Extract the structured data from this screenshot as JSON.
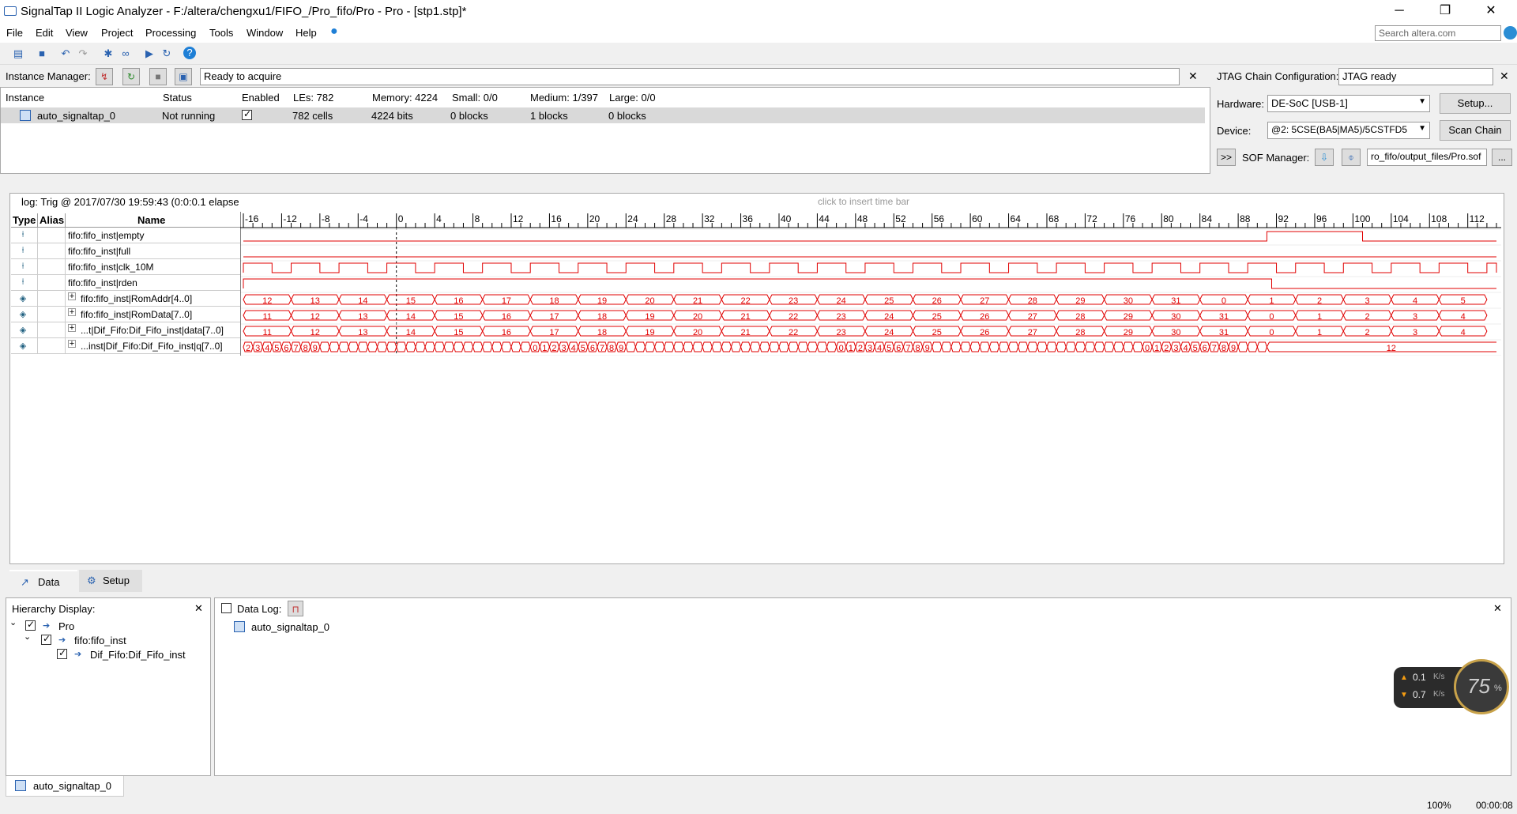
{
  "window": {
    "title": "SignalTap II Logic Analyzer - F:/altera/chengxu1/FIFO_/Pro_fifo/Pro - Pro - [stp1.stp]*",
    "minimize": "─",
    "maximize": "❐",
    "close": "✕"
  },
  "menu": [
    "File",
    "Edit",
    "View",
    "Project",
    "Processing",
    "Tools",
    "Window",
    "Help"
  ],
  "search_placeholder": "Search altera.com",
  "instance_manager": {
    "label": "Instance Manager:",
    "status": "Ready to acquire",
    "columns": [
      "Instance",
      "Status",
      "Enabled",
      "LEs: 782",
      "Memory: 4224",
      "Small: 0/0",
      "Medium: 1/397",
      "Large: 0/0"
    ],
    "row": {
      "instance": "auto_signaltap_0",
      "status": "Not running",
      "les": "782 cells",
      "memory": "4224 bits",
      "small": "0 blocks",
      "medium": "1 blocks",
      "large": "0 blocks"
    }
  },
  "jtag": {
    "label": "JTAG Chain Configuration:",
    "status": "JTAG ready",
    "hardware_label": "Hardware:",
    "hardware": "DE-SoC [USB-1]",
    "setup_button": "Setup...",
    "device_label": "Device:",
    "device": "@2: 5CSE(BA5|MA5)/5CSTFD5",
    "scan_button": "Scan Chain",
    "expand": ">>",
    "sof_label": "SOF Manager:",
    "sof_path": "ro_fifo/output_files/Pro.sof",
    "browse": "..."
  },
  "waveform": {
    "log": "log: Trig @ 2017/07/30 19:59:43 (0:0:0.1 elapse",
    "hint": "click to insert time bar",
    "headers": {
      "type": "Type",
      "alias": "Alias",
      "name": "Name"
    },
    "ticks": [
      "-16",
      "-12",
      "-8",
      "-4",
      "0",
      "4",
      "8",
      "12",
      "16",
      "20",
      "24",
      "28",
      "32",
      "36",
      "40",
      "44",
      "48",
      "52",
      "56",
      "60",
      "64",
      "68",
      "72",
      "76",
      "80",
      "84",
      "88",
      "92",
      "96",
      "100",
      "104",
      "108",
      "112"
    ],
    "signals": [
      {
        "name": "fifo:fifo_inst|empty",
        "kind": "bit"
      },
      {
        "name": "fifo:fifo_inst|full",
        "kind": "bit"
      },
      {
        "name": "fifo:fifo_inst|clk_10M",
        "kind": "bit"
      },
      {
        "name": "fifo:fifo_inst|rden",
        "kind": "bit"
      },
      {
        "name": "fifo:fifo_inst|RomAddr[4..0]",
        "kind": "bus",
        "expand": "+"
      },
      {
        "name": "fifo:fifo_inst|RomData[7..0]",
        "kind": "bus",
        "expand": "+"
      },
      {
        "name": "...t|Dif_Fifo:Dif_Fifo_inst|data[7..0]",
        "kind": "bus",
        "expand": "+"
      },
      {
        "name": "...inst|Dif_Fifo:Dif_Fifo_inst|q[7..0]",
        "kind": "bus",
        "expand": "+"
      }
    ],
    "romaddr": [
      "12",
      "13",
      "14",
      "15",
      "16",
      "17",
      "18",
      "19",
      "20",
      "21",
      "22",
      "23",
      "24",
      "25",
      "26",
      "27",
      "28",
      "29",
      "30",
      "31",
      "0",
      "1",
      "2",
      "3",
      "4",
      "5"
    ],
    "romdata": [
      "11",
      "12",
      "13",
      "14",
      "15",
      "16",
      "17",
      "18",
      "19",
      "20",
      "21",
      "22",
      "23",
      "24",
      "25",
      "26",
      "27",
      "28",
      "29",
      "30",
      "31",
      "0",
      "1",
      "2",
      "3",
      "4"
    ],
    "q_digits": [
      "2",
      "3",
      "4",
      "5",
      "6",
      "7",
      "8",
      "9",
      "0",
      "1",
      "2",
      "3",
      "4",
      "5",
      "6",
      "7",
      "8",
      "9",
      "0",
      "1",
      "2",
      "3",
      "4",
      "5",
      "6",
      "7",
      "8",
      "9",
      "0",
      "1",
      "2",
      "3",
      "4",
      "5",
      "6",
      "7",
      "8",
      "9"
    ],
    "q_final": "12",
    "color": "#e00000"
  },
  "tabs": {
    "data": "Data",
    "setup": "Setup"
  },
  "hierarchy": {
    "label": "Hierarchy Display:",
    "items": [
      {
        "label": "Pro"
      },
      {
        "label": "fifo:fifo_inst"
      },
      {
        "label": "Dif_Fifo:Dif_Fifo_inst"
      }
    ]
  },
  "datalog": {
    "label": "Data Log:",
    "item": "auto_signaltap_0"
  },
  "net": {
    "up": "0.1",
    "down": "0.7",
    "unit": "K/s",
    "pct": "75"
  },
  "bottom_tab": "auto_signaltap_0",
  "statusbar": {
    "zoom": "100%",
    "time": "00:00:08"
  }
}
